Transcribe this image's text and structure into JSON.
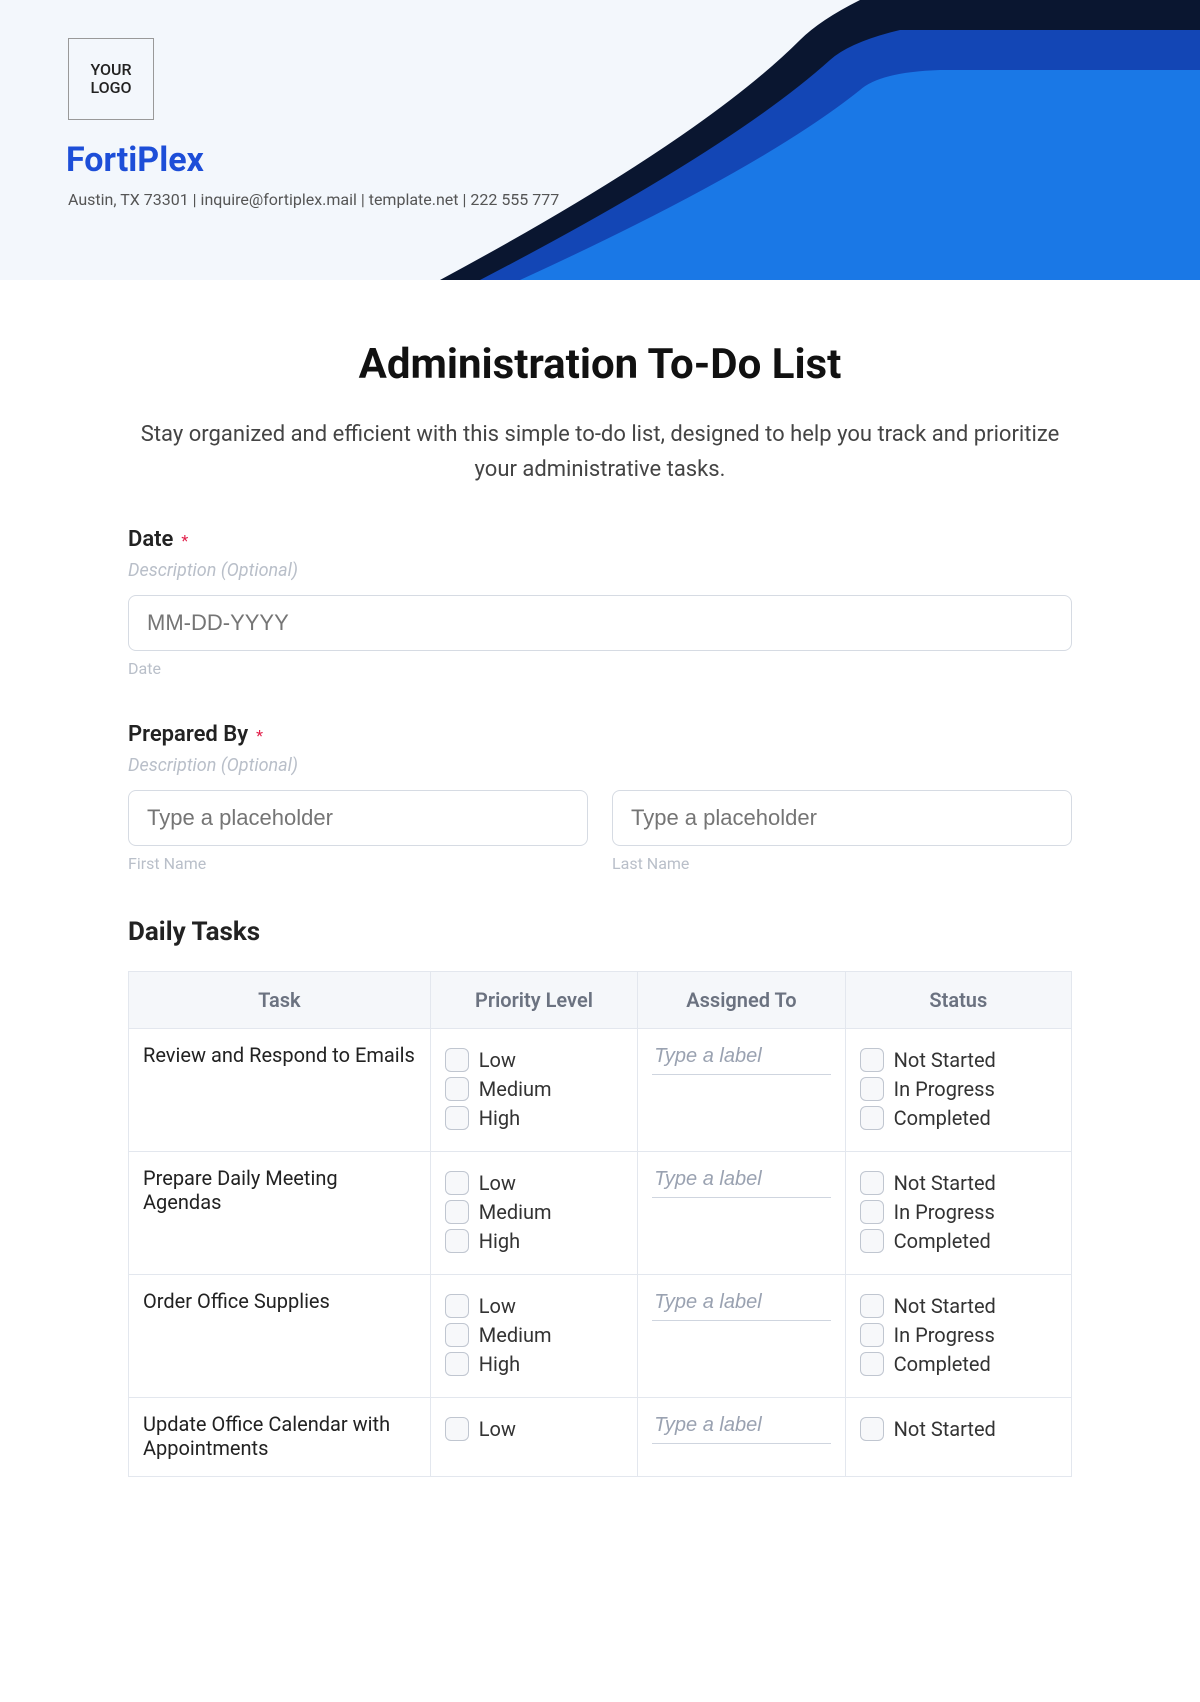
{
  "header": {
    "logo_text": "YOUR LOGO",
    "brand": "FortiPlex",
    "contact": "Austin, TX 73301 | inquire@fortiplex.mail | template.net | 222 555 777"
  },
  "title": "Administration To-Do List",
  "subhead": "Stay organized and efficient with this simple to-do list, designed to help you track and prioritize your administrative tasks.",
  "date_field": {
    "label": "Date",
    "desc": "Description (Optional)",
    "placeholder": "MM-DD-YYYY",
    "sub": "Date"
  },
  "prepared_by": {
    "label": "Prepared By",
    "desc": "Description (Optional)",
    "first_placeholder": "Type a placeholder",
    "last_placeholder": "Type a placeholder",
    "first_sub": "First Name",
    "last_sub": "Last Name"
  },
  "section_title": "Daily Tasks",
  "table": {
    "headers": {
      "task": "Task",
      "priority": "Priority Level",
      "assigned": "Assigned To",
      "status": "Status"
    },
    "priority_opts": [
      "Low",
      "Medium",
      "High"
    ],
    "status_opts": [
      "Not Started",
      "In Progress",
      "Completed"
    ],
    "assigned_placeholder": "Type a label",
    "rows": [
      {
        "task": "Review and Respond to Emails",
        "priorities_shown": 3,
        "statuses_shown": 3
      },
      {
        "task": "Prepare Daily Meeting Agendas",
        "priorities_shown": 3,
        "statuses_shown": 3
      },
      {
        "task": "Order Office Supplies",
        "priorities_shown": 3,
        "statuses_shown": 3
      },
      {
        "task": "Update Office Calendar with Appointments",
        "priorities_shown": 1,
        "statuses_shown": 1
      }
    ]
  }
}
